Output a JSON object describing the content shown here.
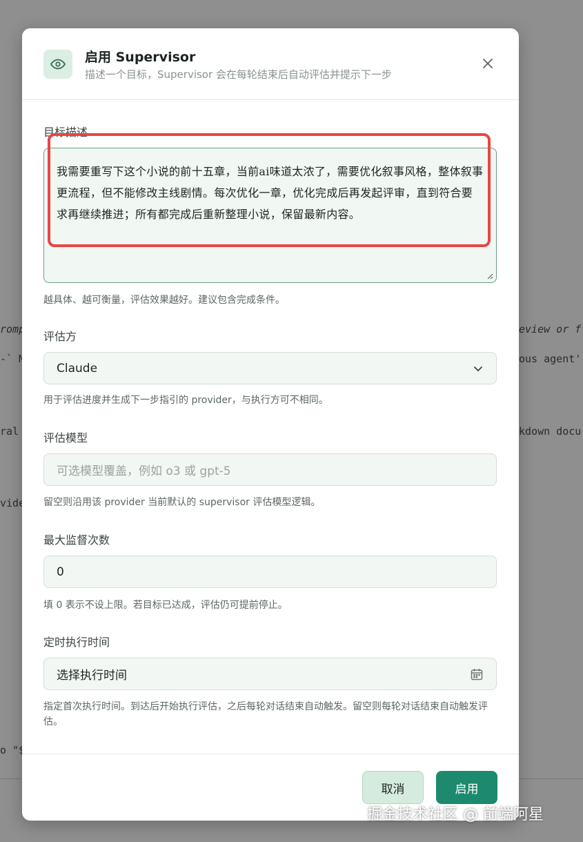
{
  "backdrop": {
    "lines": [
      {
        "id": "prompt",
        "text": "romp"
      },
      {
        "id": "review",
        "text": "eview or f"
      },
      {
        "id": "m",
        "text": "-` M"
      },
      {
        "id": "agent",
        "text": "ous agent'"
      },
      {
        "id": "ral",
        "text": "ral"
      },
      {
        "id": "kdown",
        "text": "kdown docu"
      },
      {
        "id": "vide",
        "text": "vide"
      },
      {
        "id": "dollar",
        "text": "o \"$"
      }
    ]
  },
  "dialog": {
    "icon": "eye-icon",
    "title": "启用 Supervisor",
    "subtitle": "描述一个目标，Supervisor 会在每轮结束后自动评估并提示下一步",
    "close_icon": "close-icon"
  },
  "goal": {
    "label": "目标描述",
    "value": "我需要重写下这个小说的前十五章，当前ai味道太浓了，需要优化叙事风格，整体叙事更流程，但不能修改主线剧情。每次优化一章，优化完成后再发起评审，直到符合要求再继续推进；所有都完成后重新整理小说，保留最新内容。",
    "hint": "越具体、越可衡量，评估效果越好。建议包含完成条件。"
  },
  "evaluator": {
    "label": "评估方",
    "value": "Claude",
    "icon": "chevron-down-icon",
    "hint": "用于评估进度并生成下一步指引的 provider，与执行方可不相同。"
  },
  "model": {
    "label": "评估模型",
    "placeholder": "可选模型覆盖，例如 o3 或 gpt-5",
    "hint": "留空则沿用该 provider 当前默认的 supervisor 评估模型逻辑。"
  },
  "max_count": {
    "label": "最大监督次数",
    "value": "0",
    "hint": "填 0 表示不设上限。若目标已达成，评估仍可提前停止。"
  },
  "schedule": {
    "label": "定时执行时间",
    "value": "选择执行时间",
    "icon": "calendar-icon",
    "hint": "指定首次执行时间。到达后开始执行评估，之后每轮对话结束自动触发。留空则每轮对话结束自动触发评估。"
  },
  "buttons": {
    "cancel": "取消",
    "enable": "启用"
  },
  "watermark": "掘金技术社区 @ 前端阿星",
  "colors": {
    "accent": "#1d8a6d",
    "highlight": "#e94545"
  }
}
